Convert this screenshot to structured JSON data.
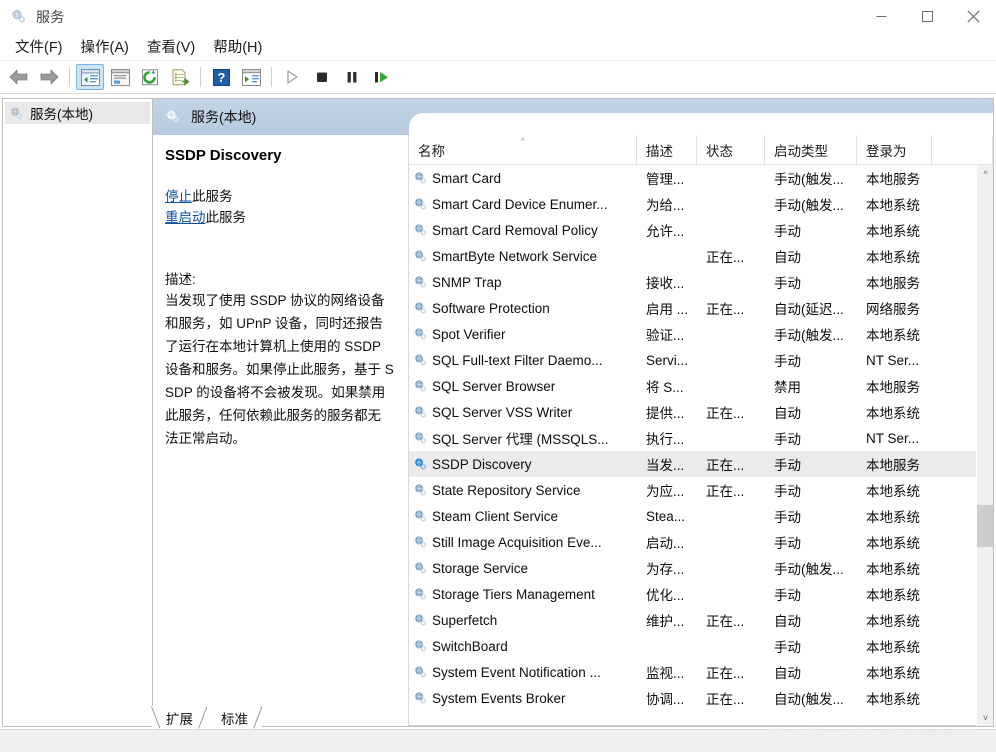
{
  "window": {
    "title": "服务",
    "icon": "services-gear-icon",
    "controls": {
      "minimize": "–",
      "maximize": "□",
      "close": "✕"
    }
  },
  "menubar": {
    "items": [
      {
        "label": "文件(F)",
        "name": "menu-file"
      },
      {
        "label": "操作(A)",
        "name": "menu-action"
      },
      {
        "label": "查看(V)",
        "name": "menu-view"
      },
      {
        "label": "帮助(H)",
        "name": "menu-help"
      }
    ]
  },
  "toolbar": {
    "buttons": [
      {
        "name": "back-icon",
        "glyph": "back"
      },
      {
        "name": "forward-icon",
        "glyph": "forward"
      },
      {
        "name": "show-hide-tree-icon",
        "glyph": "tree",
        "active": true
      },
      {
        "name": "properties-icon",
        "glyph": "properties"
      },
      {
        "name": "refresh-icon",
        "glyph": "refresh"
      },
      {
        "name": "export-list-icon",
        "glyph": "export"
      },
      {
        "name": "help-icon",
        "glyph": "help"
      },
      {
        "name": "show-action-pane-icon",
        "glyph": "actionpane"
      },
      {
        "name": "start-service-icon",
        "glyph": "play"
      },
      {
        "name": "stop-service-icon",
        "glyph": "stop"
      },
      {
        "name": "pause-service-icon",
        "glyph": "pause"
      },
      {
        "name": "restart-service-icon",
        "glyph": "restart"
      }
    ]
  },
  "tree": {
    "root": {
      "label": "服务(本地)",
      "icon": "services-node-icon"
    }
  },
  "console": {
    "header": {
      "label": "服务(本地)",
      "icon": "services-node-icon"
    }
  },
  "details": {
    "service_name": "SSDP Discovery",
    "links": [
      {
        "link_text": "停止",
        "rest_text": "此服务",
        "name": "stop-service-link"
      },
      {
        "link_text": "重启动",
        "rest_text": "此服务",
        "name": "restart-service-link"
      }
    ],
    "description_label": "描述:",
    "description_text": "当发现了使用 SSDP 协议的网络设备和服务，如 UPnP 设备，同时还报告了运行在本地计算机上使用的 SSDP 设备和服务。如果停止此服务，基于 SSDP 的设备将不会被发现。如果禁用此服务，任何依赖此服务的服务都无法正常启动。"
  },
  "list": {
    "columns": [
      {
        "label": "名称",
        "name": "column-name",
        "sorted": true
      },
      {
        "label": "描述",
        "name": "column-description"
      },
      {
        "label": "状态",
        "name": "column-status"
      },
      {
        "label": "启动类型",
        "name": "column-startup-type"
      },
      {
        "label": "登录为",
        "name": "column-log-on-as"
      }
    ],
    "rows": [
      {
        "name": "Smart Card",
        "description": "管理...",
        "status": "",
        "startup": "手动(触发...",
        "logon": "本地服务",
        "selected": false
      },
      {
        "name": "Smart Card Device Enumer...",
        "description": "为给...",
        "status": "",
        "startup": "手动(触发...",
        "logon": "本地系统",
        "selected": false
      },
      {
        "name": "Smart Card Removal Policy",
        "description": "允许...",
        "status": "",
        "startup": "手动",
        "logon": "本地系统",
        "selected": false
      },
      {
        "name": "SmartByte Network Service",
        "description": "",
        "status": "正在...",
        "startup": "自动",
        "logon": "本地系统",
        "selected": false
      },
      {
        "name": "SNMP Trap",
        "description": "接收...",
        "status": "",
        "startup": "手动",
        "logon": "本地服务",
        "selected": false
      },
      {
        "name": "Software Protection",
        "description": "启用 ...",
        "status": "正在...",
        "startup": "自动(延迟...",
        "logon": "网络服务",
        "selected": false
      },
      {
        "name": "Spot Verifier",
        "description": "验证...",
        "status": "",
        "startup": "手动(触发...",
        "logon": "本地系统",
        "selected": false
      },
      {
        "name": "SQL Full-text Filter Daemo...",
        "description": "Servi...",
        "status": "",
        "startup": "手动",
        "logon": "NT Ser...",
        "selected": false
      },
      {
        "name": "SQL Server Browser",
        "description": "将 S...",
        "status": "",
        "startup": "禁用",
        "logon": "本地服务",
        "selected": false
      },
      {
        "name": "SQL Server VSS Writer",
        "description": "提供...",
        "status": "正在...",
        "startup": "自动",
        "logon": "本地系统",
        "selected": false
      },
      {
        "name": "SQL Server 代理 (MSSQLS...",
        "description": "执行...",
        "status": "",
        "startup": "手动",
        "logon": "NT Ser...",
        "selected": false
      },
      {
        "name": "SSDP Discovery",
        "description": "当发...",
        "status": "正在...",
        "startup": "手动",
        "logon": "本地服务",
        "selected": true
      },
      {
        "name": "State Repository Service",
        "description": "为应...",
        "status": "正在...",
        "startup": "手动",
        "logon": "本地系统",
        "selected": false
      },
      {
        "name": "Steam Client Service",
        "description": "Stea...",
        "status": "",
        "startup": "手动",
        "logon": "本地系统",
        "selected": false
      },
      {
        "name": "Still Image Acquisition Eve...",
        "description": "启动...",
        "status": "",
        "startup": "手动",
        "logon": "本地系统",
        "selected": false
      },
      {
        "name": "Storage Service",
        "description": "为存...",
        "status": "",
        "startup": "手动(触发...",
        "logon": "本地系统",
        "selected": false
      },
      {
        "name": "Storage Tiers Management",
        "description": "优化...",
        "status": "",
        "startup": "手动",
        "logon": "本地系统",
        "selected": false
      },
      {
        "name": "Superfetch",
        "description": "维护...",
        "status": "正在...",
        "startup": "自动",
        "logon": "本地系统",
        "selected": false
      },
      {
        "name": "SwitchBoard",
        "description": "",
        "status": "",
        "startup": "手动",
        "logon": "本地系统",
        "selected": false
      },
      {
        "name": "System Event Notification ...",
        "description": "监视...",
        "status": "正在...",
        "startup": "自动",
        "logon": "本地系统",
        "selected": false
      },
      {
        "name": "System Events Broker",
        "description": "协调...",
        "status": "正在...",
        "startup": "自动(触发...",
        "logon": "本地系统",
        "selected": false
      }
    ]
  },
  "tabs": [
    {
      "label": "扩展",
      "name": "tab-extended",
      "active": false
    },
    {
      "label": "标准",
      "name": "tab-standard",
      "active": true
    }
  ],
  "watermark": "https://blog.csdn.net/seawaysyyy",
  "colors": {
    "console_header": "#bdd0e4",
    "selection": "#ebebeb",
    "link": "#0a50a0",
    "toolbar_active": "#cce4f7"
  }
}
